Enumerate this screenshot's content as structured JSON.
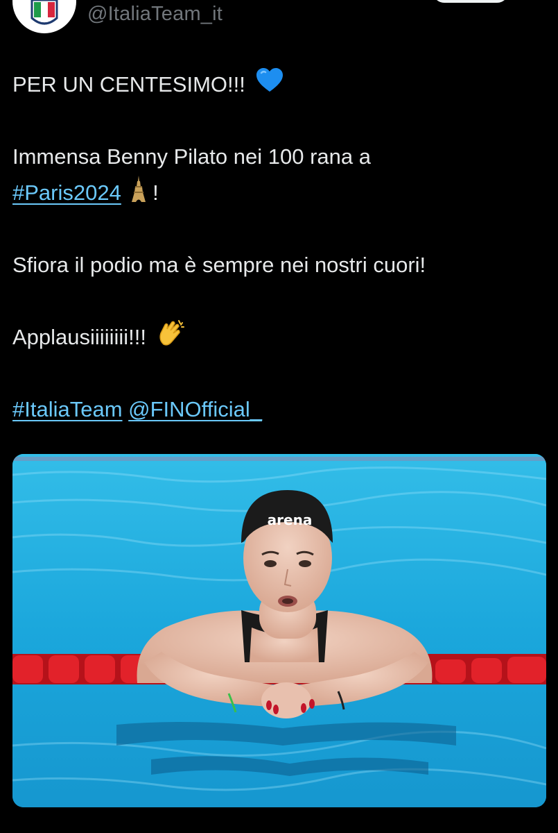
{
  "account": {
    "handle": "@ItaliaTeam_it",
    "avatar_icon": "italia-team-shield-icon"
  },
  "tweet": {
    "line1": "PER UN CENTESIMO!!!",
    "line1_emoji": "blue-heart-icon",
    "line2": "Immensa Benny Pilato nei 100 rana a",
    "line3_hashtag": "#Paris2024",
    "line3_emoji": "eiffel-tower-icon",
    "line3_end": "!",
    "line4": "Sfiora il podio ma è sempre nei nostri cuori!",
    "line5": "Applausiiiiiiii!!!",
    "line5_emoji": "clapping-hands-icon",
    "hashtag": "#ItaliaTeam",
    "mention": "@FINOfficial_"
  },
  "media": {
    "cap_text": "arena",
    "description_icon": "swimmer-photo"
  },
  "colors": {
    "background": "#000000",
    "text": "#e7e9ea",
    "secondary_text": "#71767b",
    "link": "#6bc9fb",
    "pool": "#1aa9df",
    "lane_rope": "#d4161b"
  }
}
